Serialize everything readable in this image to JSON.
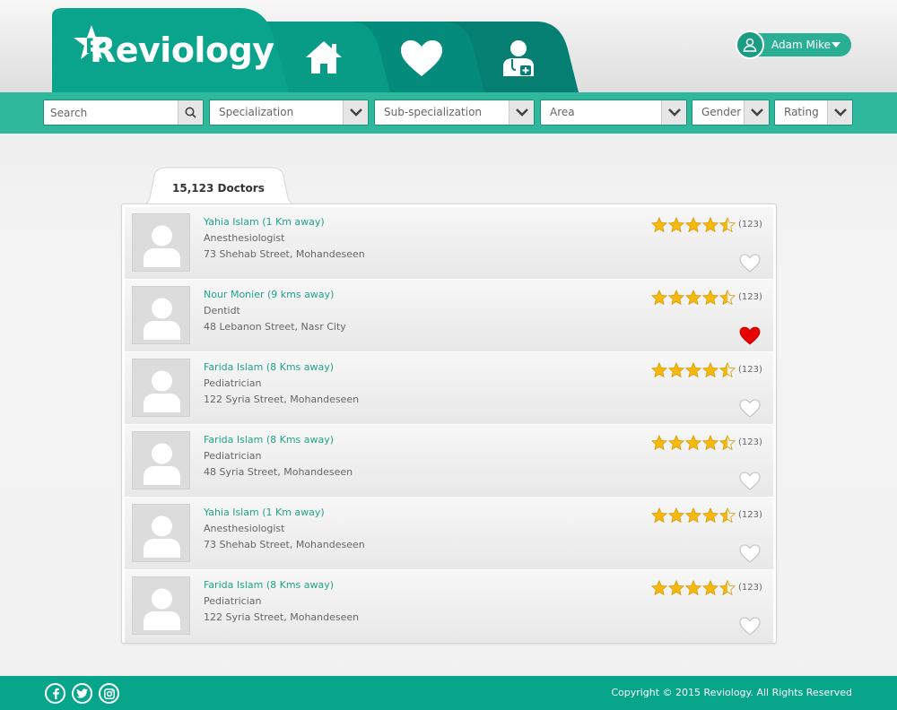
{
  "brand": {
    "name": "Reviology",
    "logo_icon": "star-icon"
  },
  "nav": [
    {
      "name": "home",
      "icon": "home-icon"
    },
    {
      "name": "favorites",
      "icon": "heart-icon"
    },
    {
      "name": "doctors",
      "icon": "doctor-icon"
    }
  ],
  "user": {
    "name": "Adam Mike",
    "icon": "user-icon"
  },
  "filters": {
    "search_placeholder": "Search",
    "specialization": "Specialization",
    "sub_specialization": "Sub-specialization",
    "area": "Area",
    "gender": "Gender",
    "rating": "Rating"
  },
  "results": {
    "count_label": "15,123 Doctors",
    "doctors": [
      {
        "name": "Yahia Islam (1 Km away)",
        "specialty": "Anesthesiologist",
        "address": "73 Shehab Street, Mohandeseen",
        "rating": 4.5,
        "reviews": "(123)",
        "favorite": false
      },
      {
        "name": "Nour Monier (9 kms away)",
        "specialty": "Dentidt",
        "address": "48 Lebanon Street, Nasr City",
        "rating": 4.5,
        "reviews": "(123)",
        "favorite": true
      },
      {
        "name": "Farida Islam (8 Kms away)",
        "specialty": "Pediatrician",
        "address": "122 Syria Street, Mohandeseen",
        "rating": 4.5,
        "reviews": "(123)",
        "favorite": false
      },
      {
        "name": "Farida Islam (8 Kms away)",
        "specialty": "Pediatrician",
        "address": "48 Syria Street, Mohandeseen",
        "rating": 4.5,
        "reviews": "(123)",
        "favorite": false
      },
      {
        "name": "Yahia Islam (1 Km away)",
        "specialty": "Anesthesiologist",
        "address": "73 Shehab Street, Mohandeseen",
        "rating": 4.5,
        "reviews": "(123)",
        "favorite": false
      },
      {
        "name": "Farida Islam (8 Kms away)",
        "specialty": "Pediatrician",
        "address": "122 Syria Street, Mohandeseen",
        "rating": 4.5,
        "reviews": "(123)",
        "favorite": false
      }
    ]
  },
  "footer": {
    "social": [
      "facebook-icon",
      "twitter-icon",
      "instagram-icon"
    ],
    "copyright": "Copyright © 2015 Reviology. All Rights Reserved"
  },
  "colors": {
    "teal": "#07a68b",
    "teal_dark": "#047a6b",
    "filter_bar": "#2fb89c",
    "link": "#20a48a",
    "favorite": "#e60000",
    "star": "#f5b90f"
  }
}
